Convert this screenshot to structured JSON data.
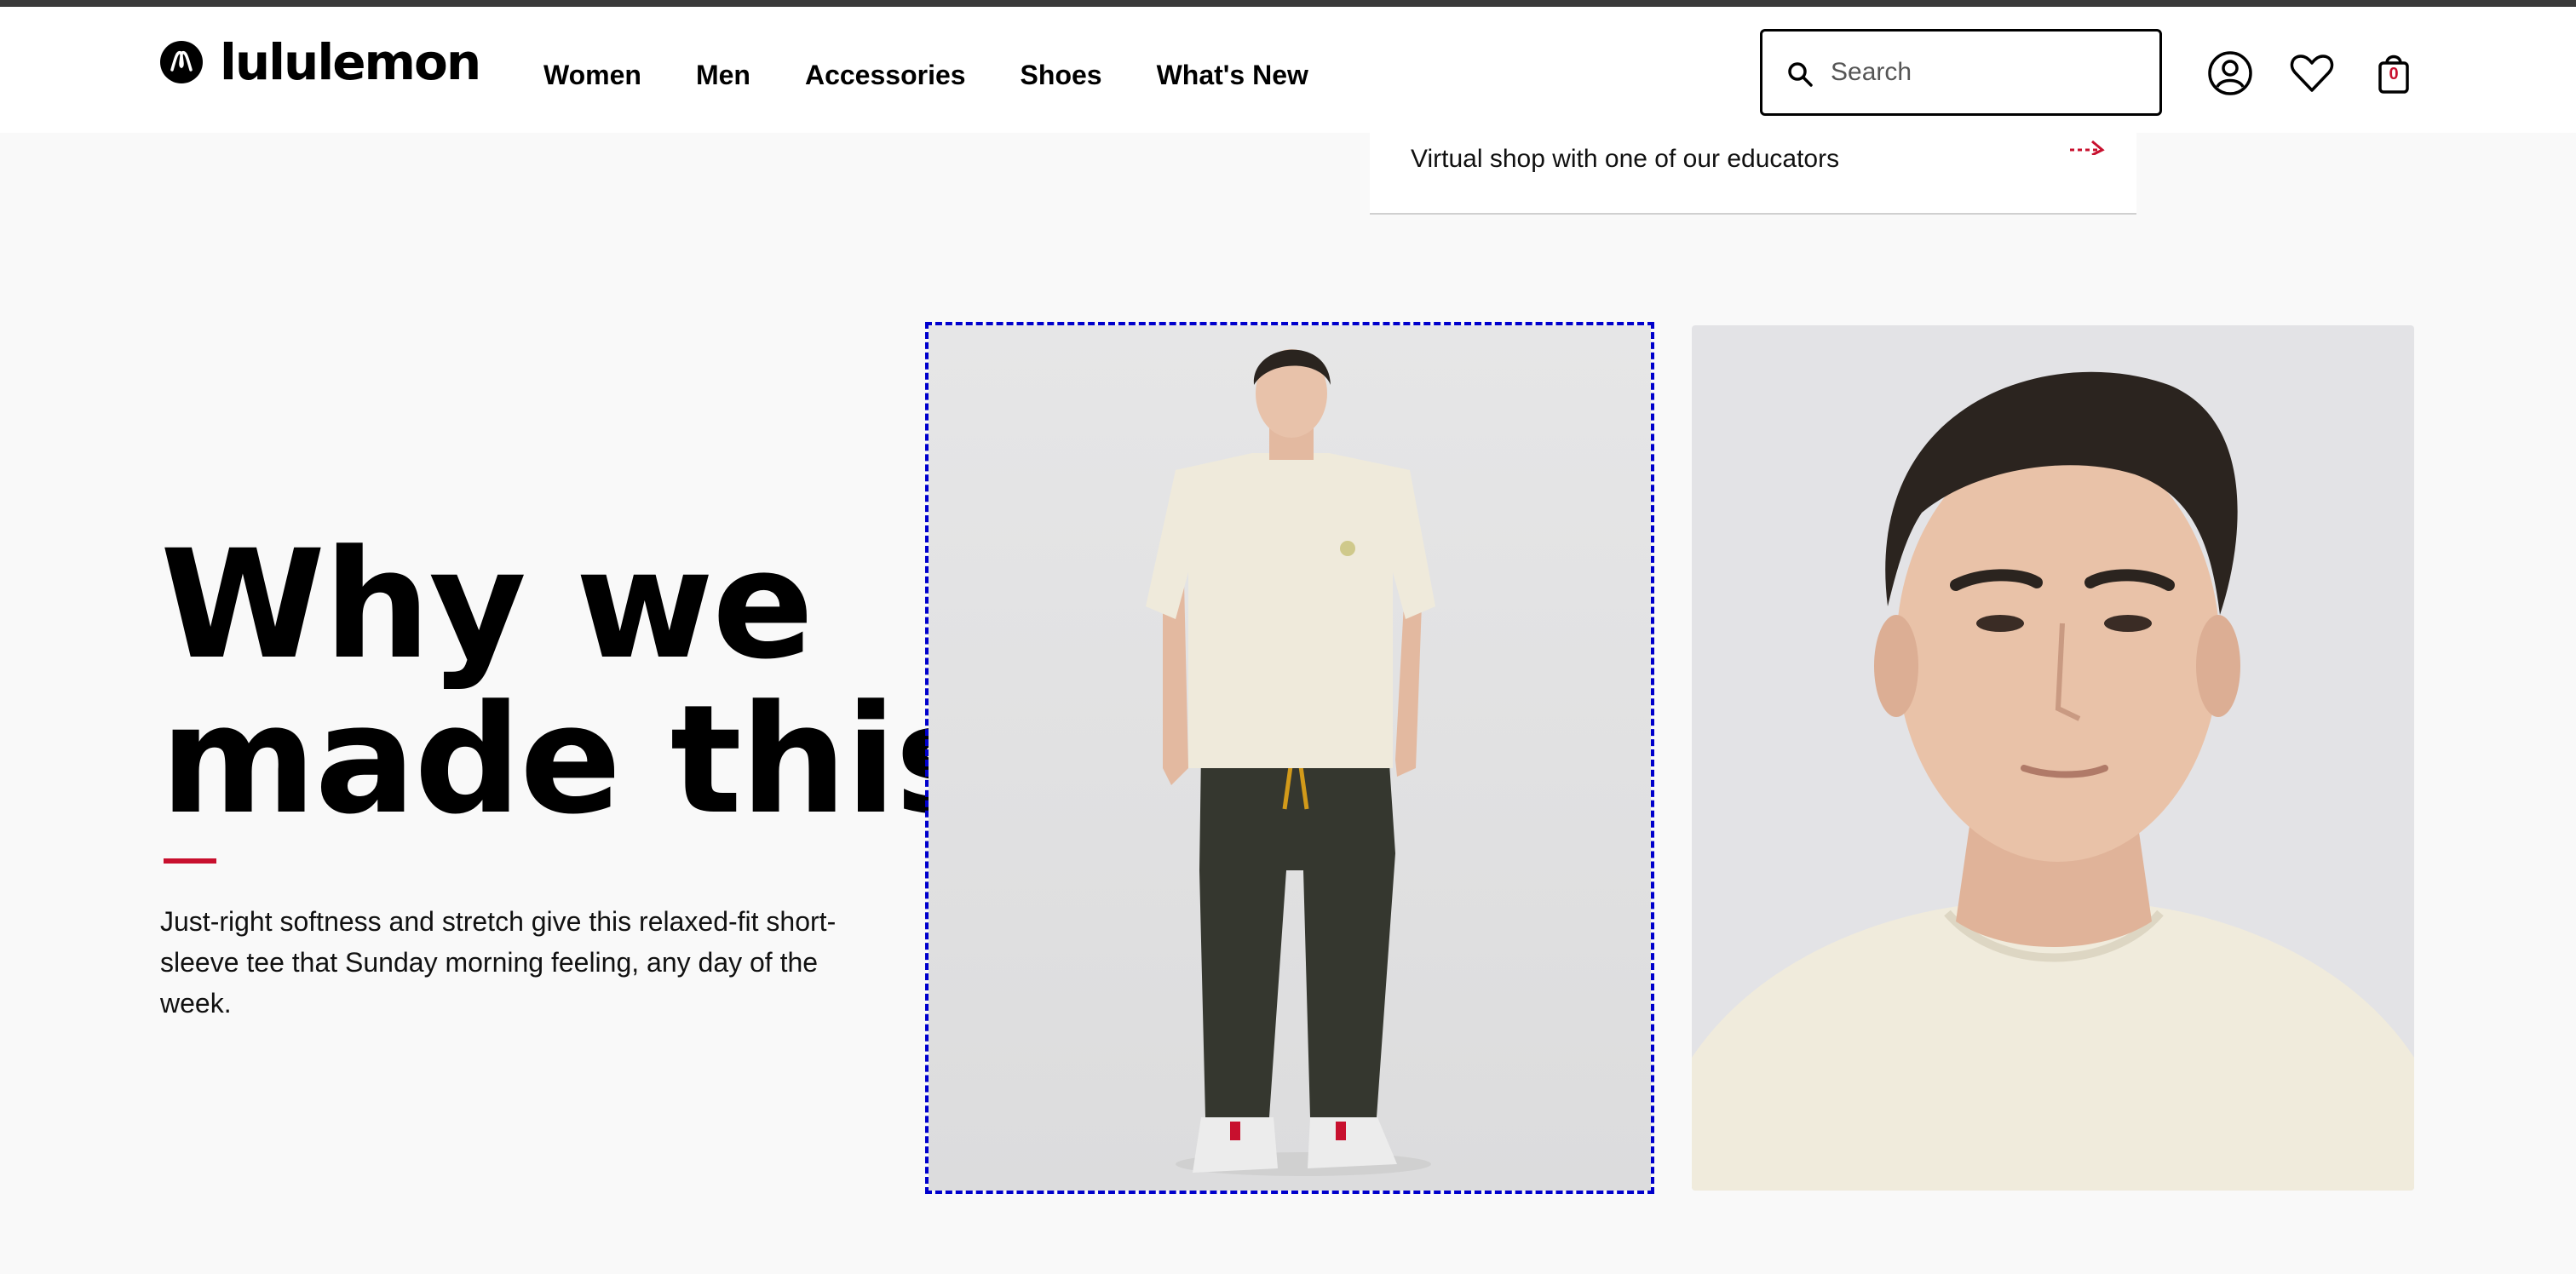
{
  "colors": {
    "accent": "#c8102e",
    "header_bg": "#ffffff",
    "page_bg": "#f9f9f9",
    "focus_outline": "#0000cc"
  },
  "brand": {
    "name": "lululemon",
    "logo_icon": "lululemon-logo-icon"
  },
  "nav": {
    "items": [
      {
        "label": "Women"
      },
      {
        "label": "Men"
      },
      {
        "label": "Accessories"
      },
      {
        "label": "Shoes"
      },
      {
        "label": "What's New"
      }
    ]
  },
  "search": {
    "placeholder": "Search",
    "value": "",
    "icon": "search-icon"
  },
  "header_icons": {
    "account": "account-icon",
    "wishlist": "heart-icon",
    "bag": "shopping-bag-icon",
    "bag_count": "0"
  },
  "promo": {
    "text": "Virtual shop with one of our educators",
    "icon": "arrow-right-icon"
  },
  "feature": {
    "headline_line1": "Why we",
    "headline_line2": "made this",
    "description": "Just-right softness and stretch give this relaxed-fit short-sleeve tee that Sunday morning feeling, any day of the week."
  },
  "images": [
    {
      "name": "product-photo-full-body",
      "alt": "Model wearing cream short-sleeve tee with dark joggers and white sneakers"
    },
    {
      "name": "product-photo-closeup",
      "alt": "Close-up portrait of model wearing cream crew-neck tee"
    }
  ]
}
